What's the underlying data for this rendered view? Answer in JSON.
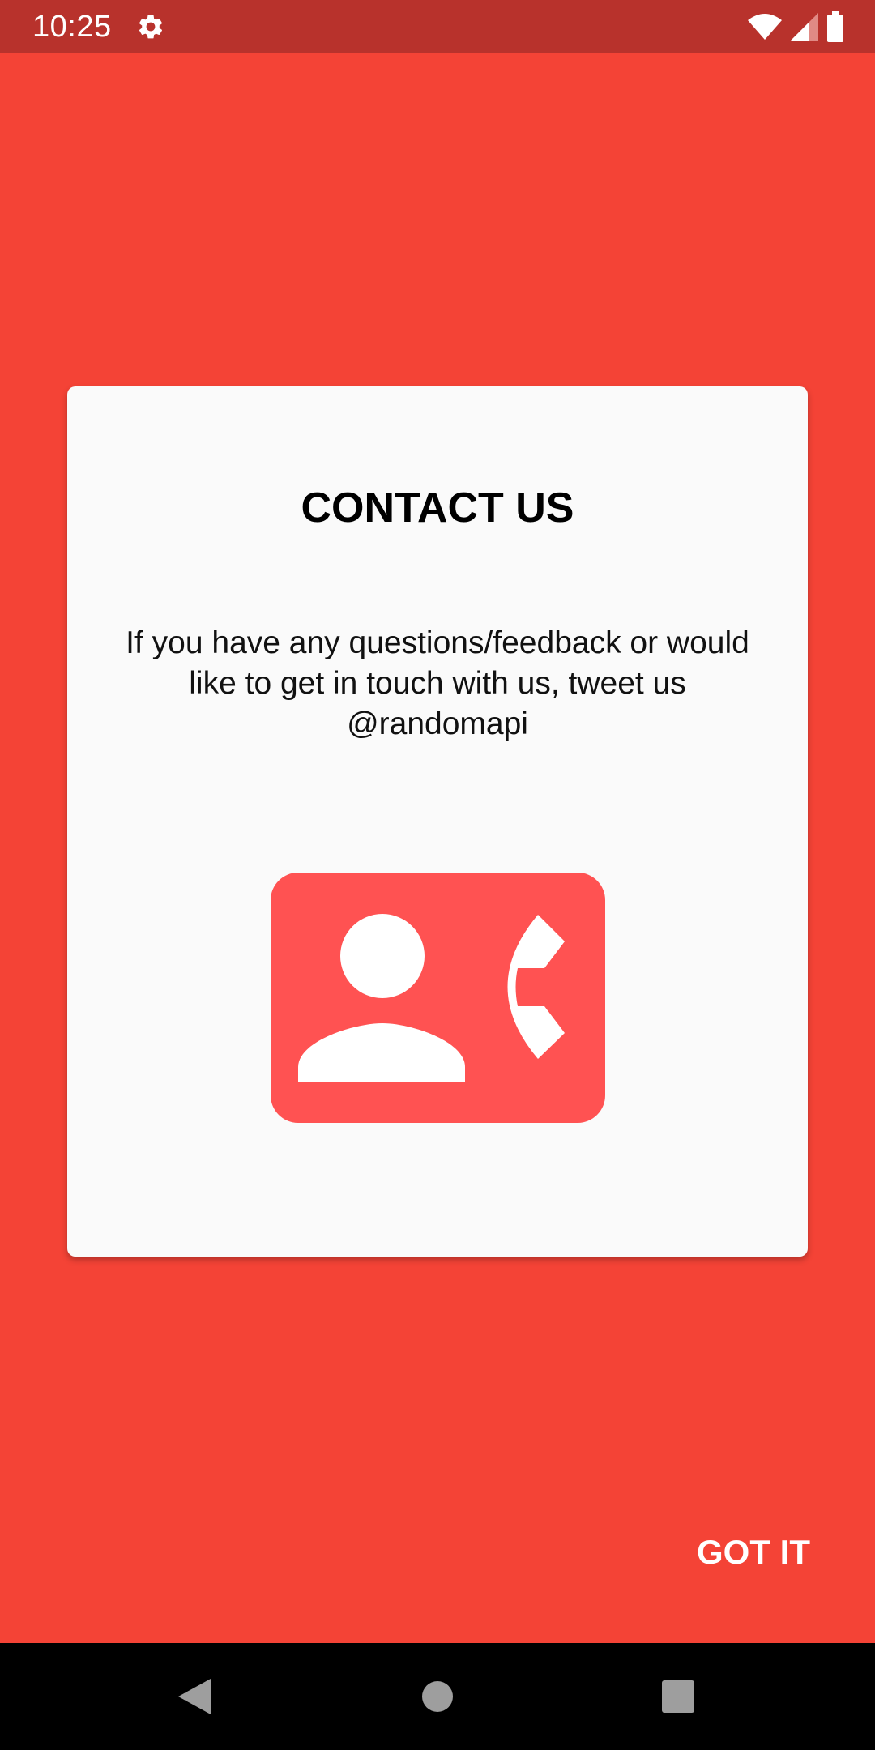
{
  "status_bar": {
    "time": "10:25",
    "icons": [
      "settings-gear-icon",
      "wifi-icon",
      "signal-icon",
      "battery-icon"
    ]
  },
  "dialog": {
    "title": "CONTACT US",
    "message": "If you have any questions/feedback or would like to get in touch with us, tweet us @randomapi",
    "illustration": "contact-phone-icon"
  },
  "actions": {
    "got_it_label": "GOT IT"
  },
  "nav_bar": {
    "buttons": [
      "back-icon",
      "home-icon",
      "recents-icon"
    ]
  },
  "colors": {
    "background": "#F44336",
    "status_bar": "#B8322C",
    "card": "#FAFAFA",
    "illustration": "#FF5252"
  }
}
